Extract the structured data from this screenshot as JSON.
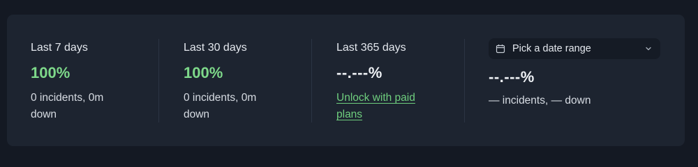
{
  "periods": [
    {
      "label": "Last 7 days",
      "percent": "100%",
      "summary": "0 incidents, 0m down"
    },
    {
      "label": "Last 30 days",
      "percent": "100%",
      "summary": "0 incidents, 0m down"
    },
    {
      "label": "Last 365 days",
      "percent": "--.---%",
      "unlock_link": "Unlock with paid plans"
    }
  ],
  "custom_range": {
    "picker_label": "Pick a date range",
    "percent": "--.---%",
    "summary": "— incidents, — down"
  },
  "colors": {
    "uptime_green": "#7ed98a",
    "link_green": "#6fcf7e",
    "panel_bg": "#1d2430",
    "page_bg": "#141923"
  },
  "icons": {
    "picker_icon": "calendar-icon",
    "picker_chevron": "chevron-down-icon"
  }
}
